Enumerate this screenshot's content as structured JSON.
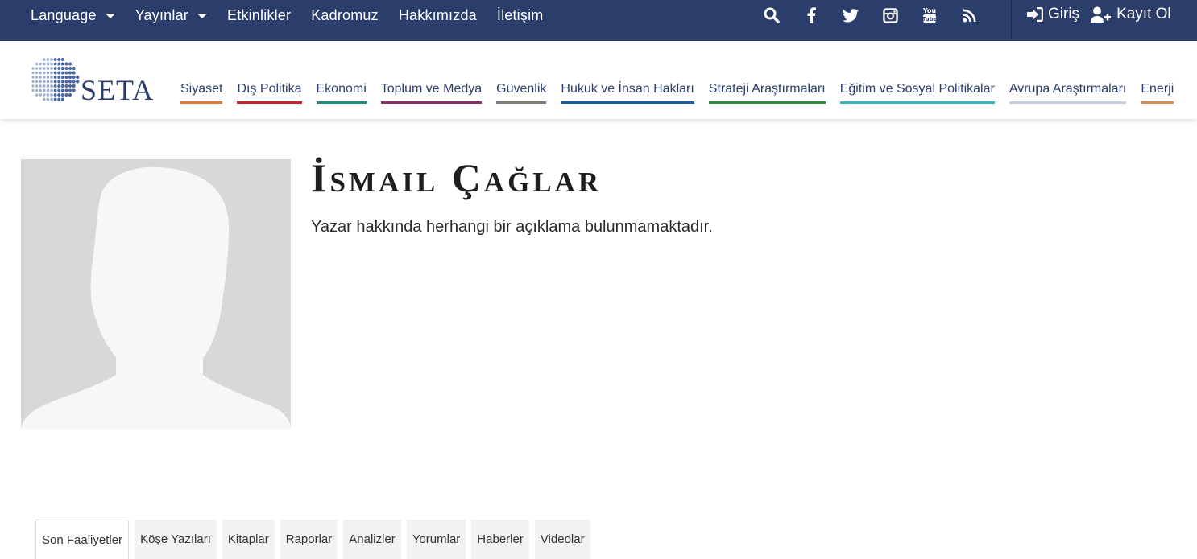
{
  "topbar": {
    "nav": [
      {
        "label": "Language",
        "dropdown": true
      },
      {
        "label": "Yayınlar",
        "dropdown": true
      },
      {
        "label": "Etkinlikler",
        "dropdown": false
      },
      {
        "label": "Kadromuz",
        "dropdown": false
      },
      {
        "label": "Hakkımızda",
        "dropdown": false
      },
      {
        "label": "İletişim",
        "dropdown": false
      }
    ],
    "icons": [
      "search-icon",
      "facebook-icon",
      "twitter-icon",
      "instagram-icon",
      "youtube-icon",
      "rss-icon"
    ],
    "login_label": "Giriş",
    "register_label": "Kayıt Ol",
    "bg_color": "#2b3d6b"
  },
  "logo": {
    "text": "SETA"
  },
  "categories": [
    {
      "label": "Siyaset",
      "color": "#e07b39"
    },
    {
      "label": "Dış Politika",
      "color": "#c8232c"
    },
    {
      "label": "Ekonomi",
      "color": "#1e8c7e"
    },
    {
      "label": "Toplum ve Medya",
      "color": "#8e2e6a"
    },
    {
      "label": "Güvenlik",
      "color": "#7b7b6e"
    },
    {
      "label": "Hukuk ve İnsan Hakları",
      "color": "#1b5ea8"
    },
    {
      "label": "Strateji Araştırmaları",
      "color": "#2e8a3c"
    },
    {
      "label": "Eğitim ve Sosyal Politikalar",
      "color": "#33b8c4"
    },
    {
      "label": "Avrupa Araştırmaları",
      "color": "#c5cfe3"
    },
    {
      "label": "Enerji",
      "color": "#d98a59"
    }
  ],
  "profile": {
    "name": "İsmail Çağlar",
    "bio": "Yazar hakkında herhangi bir açıklama bulunmamaktadır."
  },
  "tabs": [
    {
      "label": "Son Faaliyetler",
      "active": true
    },
    {
      "label": "Köşe Yazıları",
      "active": false
    },
    {
      "label": "Kitaplar",
      "active": false
    },
    {
      "label": "Raporlar",
      "active": false
    },
    {
      "label": "Analizler",
      "active": false
    },
    {
      "label": "Yorumlar",
      "active": false
    },
    {
      "label": "Haberler",
      "active": false
    },
    {
      "label": "Videolar",
      "active": false
    }
  ]
}
